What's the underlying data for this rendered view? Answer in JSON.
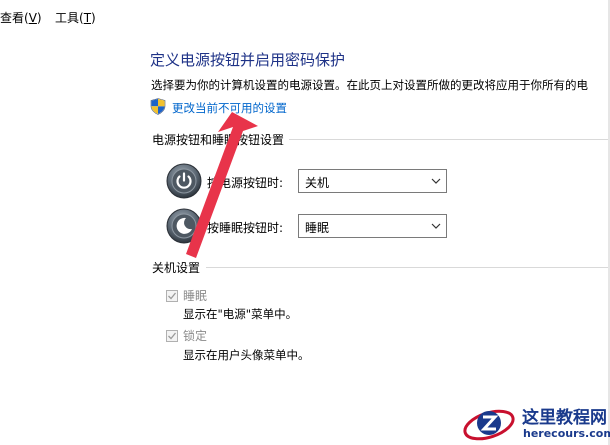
{
  "menubar": {
    "view": {
      "text": "查看(",
      "key": "V",
      "close": ")"
    },
    "tools": {
      "text": "工具(",
      "key": "T",
      "close": ")"
    }
  },
  "page": {
    "title": "定义电源按钮并启用密码保护",
    "description": "选择要为你的计算机设置的电源设置。在此页上对设置所做的更改将应用于你所有的电",
    "change_link": "更改当前不可用的设置"
  },
  "power_buttons": {
    "section_title": "电源按钮和睡眠按钮设置",
    "power_label": "按电源按钮时:",
    "power_value": "关机",
    "sleep_label": "按睡眠按钮时:",
    "sleep_value": "睡眠"
  },
  "shutdown_settings": {
    "section_title": "关机设置",
    "sleep_checkbox_label": "睡眠",
    "sleep_description": "显示在\"电源\"菜单中。",
    "lock_checkbox_label": "锁定",
    "lock_description": "显示在用户头像菜单中。"
  },
  "watermark": {
    "name": "这里教程网",
    "url": "herecours.com"
  },
  "colors": {
    "title": "#1e3287",
    "link": "#0066cc",
    "arrow": "#e8344a",
    "disabled_text": "#8a8a8a"
  },
  "icons": [
    "shield-uac-icon",
    "power-button-icon",
    "sleep-button-icon",
    "chevron-down-icon",
    "checkmark-icon",
    "red-annotation-arrow"
  ]
}
